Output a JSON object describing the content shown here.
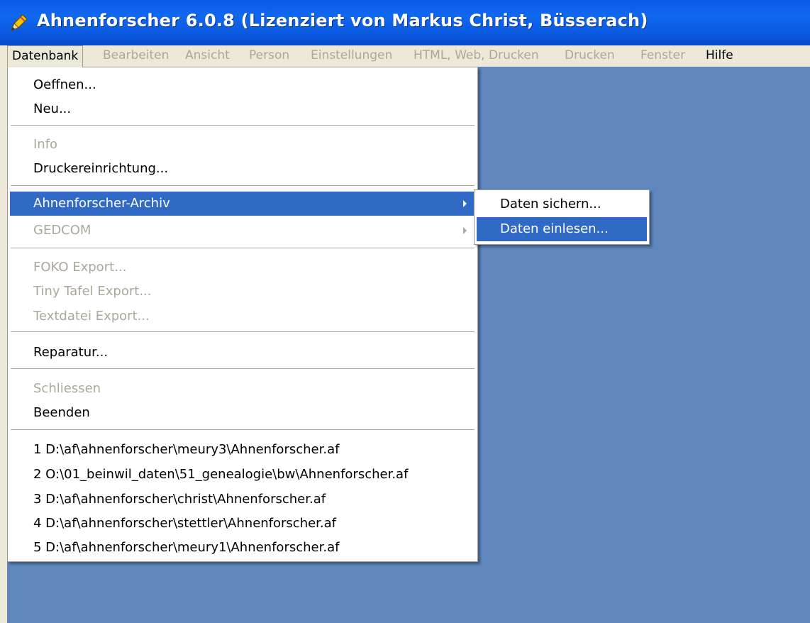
{
  "window": {
    "title": "Ahnenforscher 6.0.8 (Lizenziert von Markus Christ, Büsserach)",
    "icon": "pencil-app-icon"
  },
  "menubar": {
    "items": [
      {
        "label": "Datenbank",
        "enabled": true,
        "open": true
      },
      {
        "label": "Bearbeiten",
        "enabled": false
      },
      {
        "label": "Ansicht",
        "enabled": false
      },
      {
        "label": "Person",
        "enabled": false
      },
      {
        "label": "Einstellungen",
        "enabled": false
      },
      {
        "label": "HTML, Web, Drucken",
        "enabled": false
      },
      {
        "label": "Drucken",
        "enabled": false
      },
      {
        "label": "Fenster",
        "enabled": false
      },
      {
        "label": "Hilfe",
        "enabled": true
      }
    ]
  },
  "datenbank_menu": {
    "oeffnen": "Oeffnen...",
    "neu": "Neu...",
    "info": "Info",
    "druckereinrichtung": "Druckereinrichtung...",
    "archiv": "Ahnenforscher-Archiv",
    "gedcom": "GEDCOM",
    "foko_export": "FOKO Export...",
    "tiny_tafel_export": "Tiny Tafel Export...",
    "textdatei_export": "Textdatei Export...",
    "reparatur": "Reparatur...",
    "schliessen": "Schliessen",
    "beenden": "Beenden",
    "recent_files": [
      "1 D:\\af\\ahnenforscher\\meury3\\Ahnenforscher.af",
      "2 O:\\01_beinwil_daten\\51_genealogie\\bw\\Ahnenforscher.af",
      "3 D:\\af\\ahnenforscher\\christ\\Ahnenforscher.af",
      "4 D:\\af\\ahnenforscher\\stettler\\Ahnenforscher.af",
      "5 D:\\af\\ahnenforscher\\meury1\\Ahnenforscher.af"
    ]
  },
  "archiv_submenu": {
    "daten_sichern": "Daten sichern...",
    "daten_einlesen": "Daten einlesen..."
  },
  "colors": {
    "titlebar": "#0a5ae8",
    "menu_highlight": "#316ac5",
    "client_background": "#5f86bd",
    "disabled_text": "#aca899"
  }
}
